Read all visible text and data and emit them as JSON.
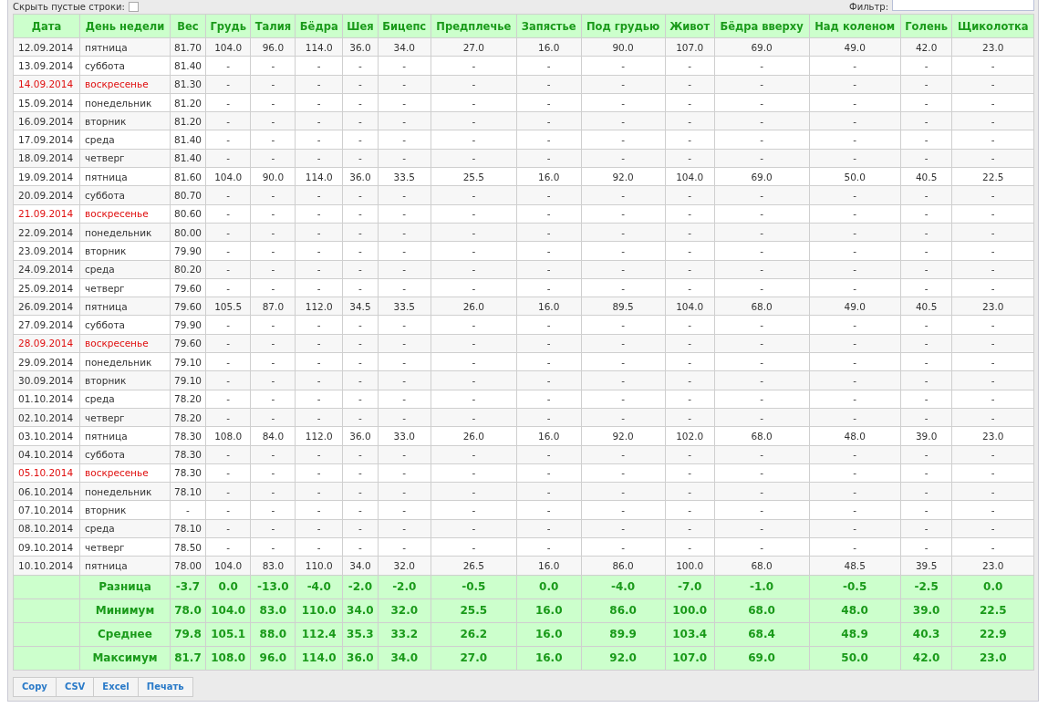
{
  "toolbar": {
    "hide_empty_label": "Скрыть пустые строки:",
    "hide_empty_checked": false,
    "filter_label": "Фильтр:"
  },
  "table": {
    "columns": [
      "Дата",
      "День недели",
      "Вес",
      "Грудь",
      "Талия",
      "Бёдра",
      "Шея",
      "Бицепс",
      "Предплечье",
      "Запястье",
      "Под грудью",
      "Живот",
      "Бёдра вверху",
      "Над коленом",
      "Голень",
      "Щиколотка"
    ],
    "rows": [
      {
        "weekend": false,
        "cells": [
          "12.09.2014",
          "пятница",
          "81.70",
          "104.0",
          "96.0",
          "114.0",
          "36.0",
          "34.0",
          "27.0",
          "16.0",
          "90.0",
          "107.0",
          "69.0",
          "49.0",
          "42.0",
          "23.0"
        ]
      },
      {
        "weekend": false,
        "cells": [
          "13.09.2014",
          "суббота",
          "81.40",
          "-",
          "-",
          "-",
          "-",
          "-",
          "-",
          "-",
          "-",
          "-",
          "-",
          "-",
          "-",
          "-"
        ]
      },
      {
        "weekend": true,
        "cells": [
          "14.09.2014",
          "воскресенье",
          "81.30",
          "-",
          "-",
          "-",
          "-",
          "-",
          "-",
          "-",
          "-",
          "-",
          "-",
          "-",
          "-",
          "-"
        ]
      },
      {
        "weekend": false,
        "cells": [
          "15.09.2014",
          "понедельник",
          "81.20",
          "-",
          "-",
          "-",
          "-",
          "-",
          "-",
          "-",
          "-",
          "-",
          "-",
          "-",
          "-",
          "-"
        ]
      },
      {
        "weekend": false,
        "cells": [
          "16.09.2014",
          "вторник",
          "81.20",
          "-",
          "-",
          "-",
          "-",
          "-",
          "-",
          "-",
          "-",
          "-",
          "-",
          "-",
          "-",
          "-"
        ]
      },
      {
        "weekend": false,
        "cells": [
          "17.09.2014",
          "среда",
          "81.40",
          "-",
          "-",
          "-",
          "-",
          "-",
          "-",
          "-",
          "-",
          "-",
          "-",
          "-",
          "-",
          "-"
        ]
      },
      {
        "weekend": false,
        "cells": [
          "18.09.2014",
          "четверг",
          "81.40",
          "-",
          "-",
          "-",
          "-",
          "-",
          "-",
          "-",
          "-",
          "-",
          "-",
          "-",
          "-",
          "-"
        ]
      },
      {
        "weekend": false,
        "cells": [
          "19.09.2014",
          "пятница",
          "81.60",
          "104.0",
          "90.0",
          "114.0",
          "36.0",
          "33.5",
          "25.5",
          "16.0",
          "92.0",
          "104.0",
          "69.0",
          "50.0",
          "40.5",
          "22.5"
        ]
      },
      {
        "weekend": false,
        "cells": [
          "20.09.2014",
          "суббота",
          "80.70",
          "-",
          "-",
          "-",
          "-",
          "-",
          "-",
          "-",
          "-",
          "-",
          "-",
          "-",
          "-",
          "-"
        ]
      },
      {
        "weekend": true,
        "cells": [
          "21.09.2014",
          "воскресенье",
          "80.60",
          "-",
          "-",
          "-",
          "-",
          "-",
          "-",
          "-",
          "-",
          "-",
          "-",
          "-",
          "-",
          "-"
        ]
      },
      {
        "weekend": false,
        "cells": [
          "22.09.2014",
          "понедельник",
          "80.00",
          "-",
          "-",
          "-",
          "-",
          "-",
          "-",
          "-",
          "-",
          "-",
          "-",
          "-",
          "-",
          "-"
        ]
      },
      {
        "weekend": false,
        "cells": [
          "23.09.2014",
          "вторник",
          "79.90",
          "-",
          "-",
          "-",
          "-",
          "-",
          "-",
          "-",
          "-",
          "-",
          "-",
          "-",
          "-",
          "-"
        ]
      },
      {
        "weekend": false,
        "cells": [
          "24.09.2014",
          "среда",
          "80.20",
          "-",
          "-",
          "-",
          "-",
          "-",
          "-",
          "-",
          "-",
          "-",
          "-",
          "-",
          "-",
          "-"
        ]
      },
      {
        "weekend": false,
        "cells": [
          "25.09.2014",
          "четверг",
          "79.60",
          "-",
          "-",
          "-",
          "-",
          "-",
          "-",
          "-",
          "-",
          "-",
          "-",
          "-",
          "-",
          "-"
        ]
      },
      {
        "weekend": false,
        "cells": [
          "26.09.2014",
          "пятница",
          "79.60",
          "105.5",
          "87.0",
          "112.0",
          "34.5",
          "33.5",
          "26.0",
          "16.0",
          "89.5",
          "104.0",
          "68.0",
          "49.0",
          "40.5",
          "23.0"
        ]
      },
      {
        "weekend": false,
        "cells": [
          "27.09.2014",
          "суббота",
          "79.90",
          "-",
          "-",
          "-",
          "-",
          "-",
          "-",
          "-",
          "-",
          "-",
          "-",
          "-",
          "-",
          "-"
        ]
      },
      {
        "weekend": true,
        "cells": [
          "28.09.2014",
          "воскресенье",
          "79.60",
          "-",
          "-",
          "-",
          "-",
          "-",
          "-",
          "-",
          "-",
          "-",
          "-",
          "-",
          "-",
          "-"
        ]
      },
      {
        "weekend": false,
        "cells": [
          "29.09.2014",
          "понедельник",
          "79.10",
          "-",
          "-",
          "-",
          "-",
          "-",
          "-",
          "-",
          "-",
          "-",
          "-",
          "-",
          "-",
          "-"
        ]
      },
      {
        "weekend": false,
        "cells": [
          "30.09.2014",
          "вторник",
          "79.10",
          "-",
          "-",
          "-",
          "-",
          "-",
          "-",
          "-",
          "-",
          "-",
          "-",
          "-",
          "-",
          "-"
        ]
      },
      {
        "weekend": false,
        "cells": [
          "01.10.2014",
          "среда",
          "78.20",
          "-",
          "-",
          "-",
          "-",
          "-",
          "-",
          "-",
          "-",
          "-",
          "-",
          "-",
          "-",
          "-"
        ]
      },
      {
        "weekend": false,
        "cells": [
          "02.10.2014",
          "четверг",
          "78.20",
          "-",
          "-",
          "-",
          "-",
          "-",
          "-",
          "-",
          "-",
          "-",
          "-",
          "-",
          "-",
          "-"
        ]
      },
      {
        "weekend": false,
        "cells": [
          "03.10.2014",
          "пятница",
          "78.30",
          "108.0",
          "84.0",
          "112.0",
          "36.0",
          "33.0",
          "26.0",
          "16.0",
          "92.0",
          "102.0",
          "68.0",
          "48.0",
          "39.0",
          "23.0"
        ]
      },
      {
        "weekend": false,
        "cells": [
          "04.10.2014",
          "суббота",
          "78.30",
          "-",
          "-",
          "-",
          "-",
          "-",
          "-",
          "-",
          "-",
          "-",
          "-",
          "-",
          "-",
          "-"
        ]
      },
      {
        "weekend": true,
        "cells": [
          "05.10.2014",
          "воскресенье",
          "78.30",
          "-",
          "-",
          "-",
          "-",
          "-",
          "-",
          "-",
          "-",
          "-",
          "-",
          "-",
          "-",
          "-"
        ]
      },
      {
        "weekend": false,
        "cells": [
          "06.10.2014",
          "понедельник",
          "78.10",
          "-",
          "-",
          "-",
          "-",
          "-",
          "-",
          "-",
          "-",
          "-",
          "-",
          "-",
          "-",
          "-"
        ]
      },
      {
        "weekend": false,
        "cells": [
          "07.10.2014",
          "вторник",
          "-",
          "-",
          "-",
          "-",
          "-",
          "-",
          "-",
          "-",
          "-",
          "-",
          "-",
          "-",
          "-",
          "-"
        ]
      },
      {
        "weekend": false,
        "cells": [
          "08.10.2014",
          "среда",
          "78.10",
          "-",
          "-",
          "-",
          "-",
          "-",
          "-",
          "-",
          "-",
          "-",
          "-",
          "-",
          "-",
          "-"
        ]
      },
      {
        "weekend": false,
        "cells": [
          "09.10.2014",
          "четверг",
          "78.50",
          "-",
          "-",
          "-",
          "-",
          "-",
          "-",
          "-",
          "-",
          "-",
          "-",
          "-",
          "-",
          "-"
        ]
      },
      {
        "weekend": false,
        "cells": [
          "10.10.2014",
          "пятница",
          "78.00",
          "104.0",
          "83.0",
          "110.0",
          "34.0",
          "32.0",
          "26.5",
          "16.0",
          "86.0",
          "100.0",
          "68.0",
          "48.5",
          "39.5",
          "23.0"
        ]
      }
    ],
    "summary": [
      {
        "label": "Разница",
        "values": [
          "-3.7",
          "0.0",
          "-13.0",
          "-4.0",
          "-2.0",
          "-2.0",
          "-0.5",
          "0.0",
          "-4.0",
          "-7.0",
          "-1.0",
          "-0.5",
          "-2.5",
          "0.0"
        ]
      },
      {
        "label": "Минимум",
        "values": [
          "78.0",
          "104.0",
          "83.0",
          "110.0",
          "34.0",
          "32.0",
          "25.5",
          "16.0",
          "86.0",
          "100.0",
          "68.0",
          "48.0",
          "39.0",
          "22.5"
        ]
      },
      {
        "label": "Среднее",
        "values": [
          "79.8",
          "105.1",
          "88.0",
          "112.4",
          "35.3",
          "33.2",
          "26.2",
          "16.0",
          "89.9",
          "103.4",
          "68.4",
          "48.9",
          "40.3",
          "22.9"
        ]
      },
      {
        "label": "Максимум",
        "values": [
          "81.7",
          "108.0",
          "96.0",
          "114.0",
          "36.0",
          "34.0",
          "27.0",
          "16.0",
          "92.0",
          "107.0",
          "69.0",
          "50.0",
          "42.0",
          "23.0"
        ]
      }
    ]
  },
  "export_buttons": [
    "Copy",
    "CSV",
    "Excel",
    "Печать"
  ]
}
